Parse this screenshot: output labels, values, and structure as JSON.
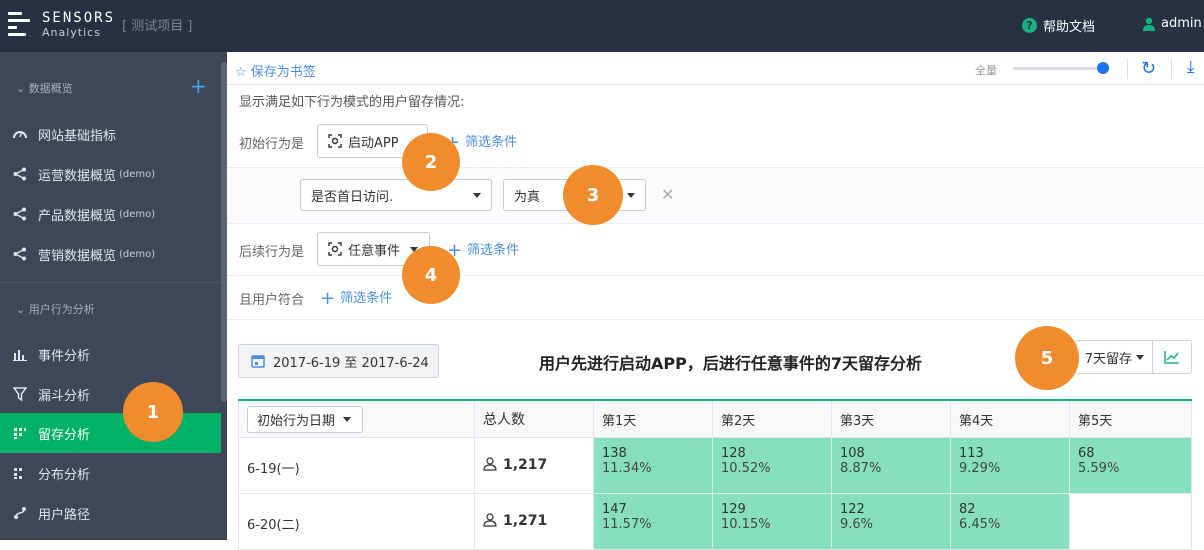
{
  "topbar": {
    "brand_line1": "SENSORS",
    "brand_line2": "Analytics",
    "project": "[ 测试项目 ]",
    "help": "帮助文档",
    "user": "admin"
  },
  "sidebar": {
    "section1": "数据概览",
    "items1": [
      {
        "label": "网站基础指标",
        "sub": ""
      },
      {
        "label": "运营数据概览",
        "sub": "(demo)"
      },
      {
        "label": "产品数据概览",
        "sub": "(demo)"
      },
      {
        "label": "营销数据概览",
        "sub": "(demo)"
      }
    ],
    "section2": "用户行为分析",
    "items2": [
      {
        "label": "事件分析"
      },
      {
        "label": "漏斗分析"
      },
      {
        "label": "留存分析"
      },
      {
        "label": "分布分析"
      },
      {
        "label": "用户路径"
      }
    ]
  },
  "toolbar": {
    "bookmark": "保存为书签",
    "zoom_label": "全量"
  },
  "query": {
    "desc": "显示满足如下行为模式的用户留存情况:",
    "initial_label": "初始行为是",
    "initial_event": "启动APP",
    "filter_add": "筛选条件",
    "prop_select": "是否首日访问.",
    "op_select": "为真",
    "followup_label": "后续行为是",
    "followup_event": "任意事件",
    "user_label": "且用户符合"
  },
  "result": {
    "date_range": "2017-6-19 至 2017-6-24",
    "title": "用户先进行启动APP，后进行任意事件的7天留存分析",
    "retention_select": "7天留存"
  },
  "table": {
    "headers": [
      "初始行为日期",
      "总人数",
      "第1天",
      "第2天",
      "第3天",
      "第4天",
      "第5天"
    ],
    "rows": [
      {
        "date": "6-19(一)",
        "total": "1,217",
        "cells": [
          [
            "138",
            "11.34%"
          ],
          [
            "128",
            "10.52%"
          ],
          [
            "108",
            "8.87%"
          ],
          [
            "113",
            "9.29%"
          ],
          [
            "68",
            "5.59%"
          ]
        ]
      },
      {
        "date": "6-20(二)",
        "total": "1,271",
        "cells": [
          [
            "147",
            "11.57%"
          ],
          [
            "129",
            "10.15%"
          ],
          [
            "122",
            "9.6%"
          ],
          [
            "82",
            "6.45%"
          ],
          [
            "",
            ""
          ]
        ]
      }
    ]
  },
  "badges": [
    "1",
    "2",
    "3",
    "4",
    "5"
  ],
  "colors": {
    "topbar": "#283142",
    "sidebar": "#3d4757",
    "active": "#01b167",
    "accent": "#4a90e2",
    "badge": "#f08c2e",
    "cell": "#86e0bd"
  }
}
